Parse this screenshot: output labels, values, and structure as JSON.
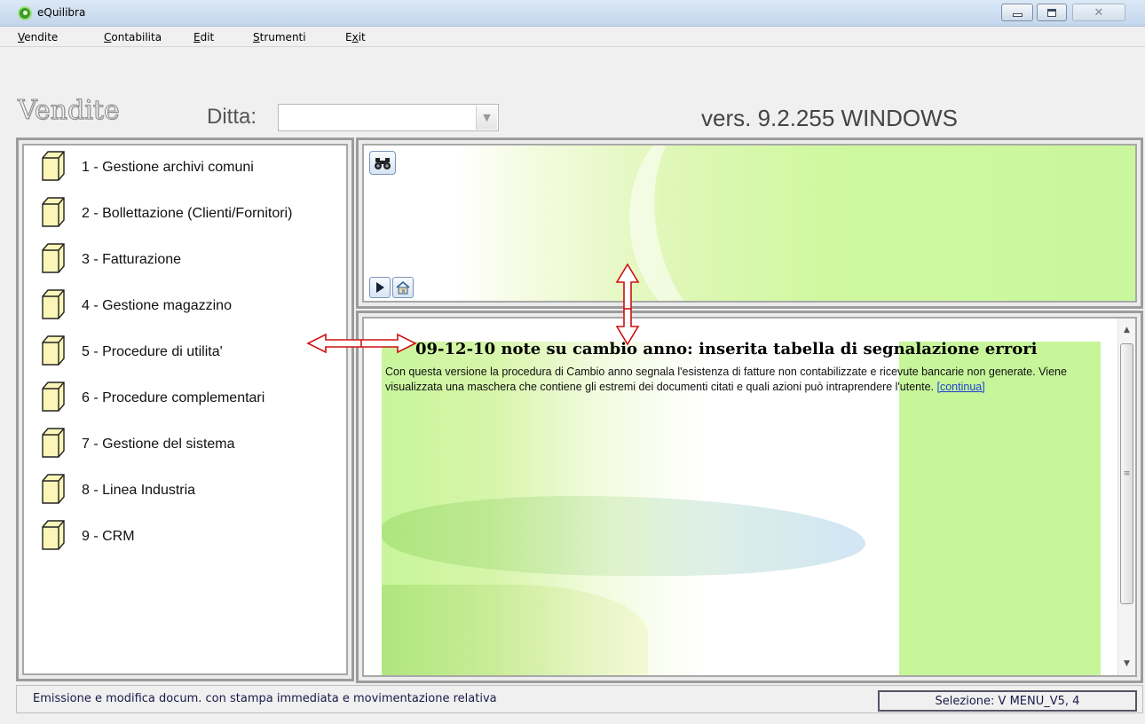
{
  "window": {
    "title": "eQuilibra",
    "minimize_label": "",
    "close_label": "✕"
  },
  "menubar": {
    "items": [
      {
        "first": "V",
        "rest": "endite"
      },
      {
        "first": "C",
        "rest": "ontabilita"
      },
      {
        "first": "E",
        "rest": "dit"
      },
      {
        "first": "S",
        "rest": "trumenti"
      },
      {
        "first": "E",
        "rest": "x",
        "after": "it"
      }
    ]
  },
  "header": {
    "module_title": "Vendite",
    "ditta_label": "Ditta:",
    "ditta_value": "",
    "version": "vers. 9.2.255 WINDOWS"
  },
  "menu_tree": {
    "items": [
      {
        "label": "1 - Gestione archivi comuni"
      },
      {
        "label": "2 - Bollettazione (Clienti/Fornitori)"
      },
      {
        "label": "3 - Fatturazione"
      },
      {
        "label": "4 - Gestione magazzino"
      },
      {
        "label": "5 - Procedure di utilita'"
      },
      {
        "label": "6 - Procedure complementari"
      },
      {
        "label": "7 - Gestione del sistema"
      },
      {
        "label": "8 - Linea Industria"
      },
      {
        "label": "9 - CRM"
      }
    ]
  },
  "news": {
    "title": "09-12-10 note su cambio anno: inserita tabella di segnalazione errori",
    "body": "Con questa versione la procedura di Cambio anno segnala l'esistenza di fatture non contabilizzate e ricevute bancarie non generate. Viene visualizzata una maschera che contiene gli estremi dei documenti citati e quali azioni può intraprendere l'utente. ",
    "link": "[continua]"
  },
  "status": {
    "message": "Emissione e modifica docum. con stampa immediata e movimentazione relativa",
    "selection": "Selezione: V MENU_V5, 4"
  },
  "colors": {
    "accent_green": "#c9f79c",
    "link": "#1f3fd1",
    "arrow_red": "#d01010"
  }
}
